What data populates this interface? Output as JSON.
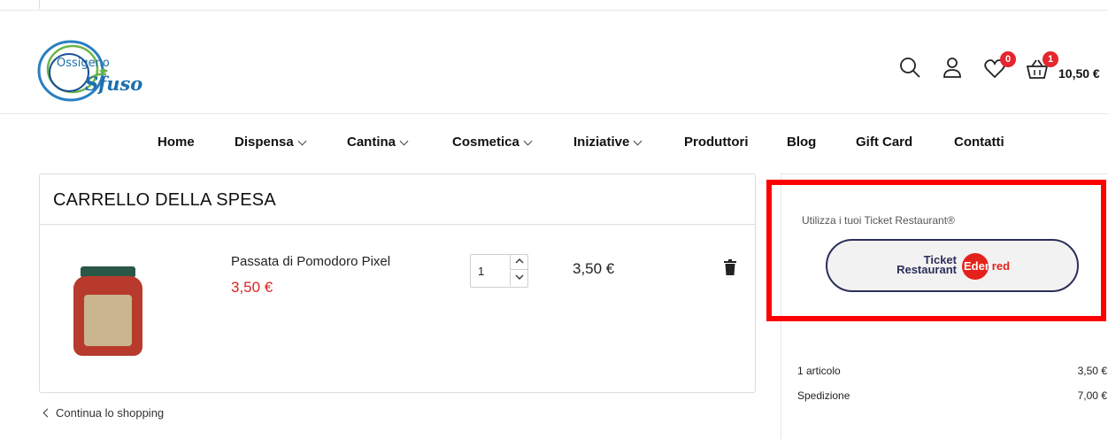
{
  "header": {
    "logo": {
      "line1": "Ossigeno",
      "line2": "Sfuso"
    },
    "wishlist_count": "0",
    "cart_count": "1",
    "cart_total": "10,50 €"
  },
  "nav": {
    "items": [
      {
        "label": "Home",
        "has_dropdown": false
      },
      {
        "label": "Dispensa",
        "has_dropdown": true
      },
      {
        "label": "Cantina",
        "has_dropdown": true
      },
      {
        "label": "Cosmetica",
        "has_dropdown": true
      },
      {
        "label": "Iniziative",
        "has_dropdown": true
      },
      {
        "label": "Produttori",
        "has_dropdown": false
      },
      {
        "label": "Blog",
        "has_dropdown": false
      },
      {
        "label": "Gift Card",
        "has_dropdown": false
      },
      {
        "label": "Contatti",
        "has_dropdown": false
      }
    ]
  },
  "cart": {
    "title": "CARRELLO DELLA SPESA",
    "items": [
      {
        "name": "Passata di Pomodoro Pixel",
        "unit_price": "3,50 €",
        "quantity": "1",
        "line_total": "3,50 €"
      }
    ],
    "continue_label": "Continua lo shopping"
  },
  "sidebar": {
    "ticket_text": "Utilizza i tuoi Ticket Restaurant®",
    "ticket_logo": {
      "word1": "Ticket",
      "word2": "Restaurant",
      "brand_white": "Eden",
      "brand_red": "red"
    },
    "summary": {
      "articles_label": "1 articolo",
      "articles_value": "3,50 €",
      "shipping_label": "Spedizione",
      "shipping_value": "7,00 €"
    }
  },
  "colors": {
    "accent_red": "#e5262e",
    "price_red": "#d9251f",
    "ticket_navy": "#2b2f5a",
    "highlight": "#ff0000"
  }
}
